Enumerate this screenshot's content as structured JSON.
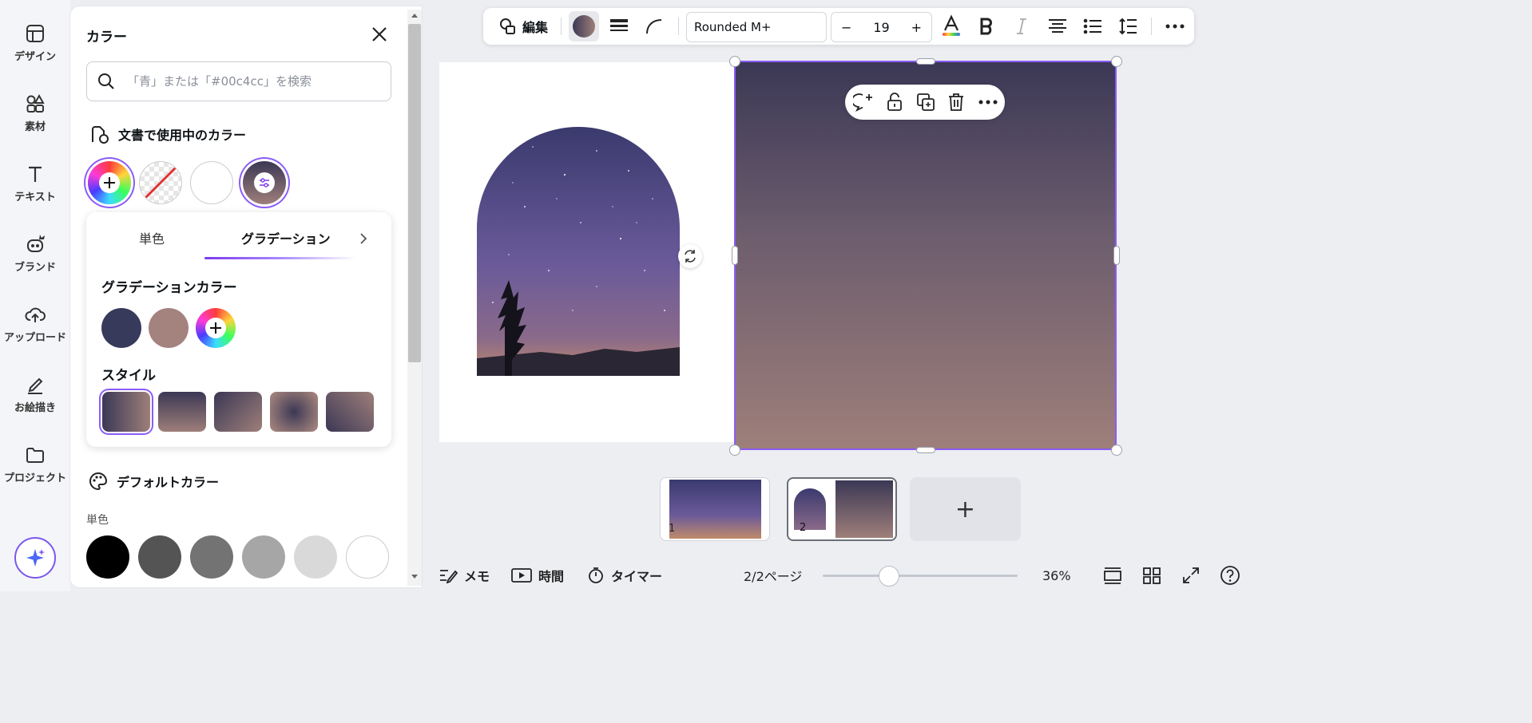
{
  "rail": {
    "items": [
      {
        "label": "デザイン",
        "icon": "layout-icon"
      },
      {
        "label": "素材",
        "icon": "elements-icon"
      },
      {
        "label": "テキスト",
        "icon": "text-icon"
      },
      {
        "label": "ブランド",
        "icon": "brand-icon"
      },
      {
        "label": "アップロード",
        "icon": "upload-cloud-icon"
      },
      {
        "label": "お絵描き",
        "icon": "draw-icon"
      },
      {
        "label": "プロジェクト",
        "icon": "folder-icon"
      }
    ],
    "magic_icon": "sparkle-icon"
  },
  "color_panel": {
    "title": "カラー",
    "search_placeholder": "「青」または「#00c4cc」を検索",
    "document_colors_title": "文書で使用中のカラー",
    "document_colors": [
      "rainbow-add",
      "transparent",
      "#ffffff",
      "gradient-edit"
    ],
    "tabs": {
      "solid": "単色",
      "gradient": "グラデーション"
    },
    "gradient_colors_title": "グラデーションカラー",
    "gradient_colors": [
      "#383a5c",
      "#a4827e"
    ],
    "style_title": "スタイル",
    "default_colors_title": "デフォルトカラー",
    "solid_label": "単色",
    "default_solid_colors": [
      "#000000",
      "#545454",
      "#737373",
      "#a6a6a6",
      "#d9d9d9",
      "#ffffff"
    ]
  },
  "toolbar": {
    "edit_label": "編集",
    "font_name": "Rounded M+",
    "font_size": "19",
    "minus": "−",
    "plus": "+"
  },
  "canvas": {
    "gradient_top": "#3b3855",
    "gradient_bottom": "#9e7f7a"
  },
  "pages": {
    "thumbs": [
      "1",
      "2"
    ],
    "add": "+"
  },
  "bottom_bar": {
    "notes": "メモ",
    "time": "時間",
    "timer": "タイマー",
    "page_indicator": "2/2ページ",
    "zoom": "36%",
    "zoom_level_percent": 36
  },
  "accent_color": "#8b5cf6"
}
